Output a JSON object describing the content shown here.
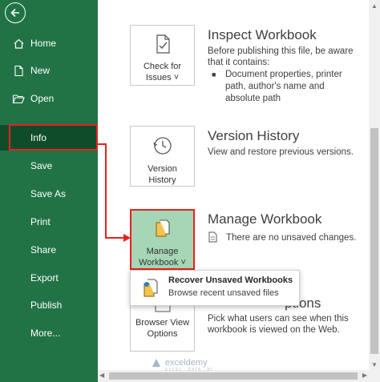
{
  "sidebar": {
    "items": [
      {
        "label": "Home",
        "icon": "home-icon"
      },
      {
        "label": "New",
        "icon": "new-document-icon"
      },
      {
        "label": "Open",
        "icon": "folder-open-icon"
      },
      {
        "label": "Info"
      },
      {
        "label": "Save"
      },
      {
        "label": "Save As"
      },
      {
        "label": "Print"
      },
      {
        "label": "Share"
      },
      {
        "label": "Export"
      },
      {
        "label": "Publish"
      },
      {
        "label": "More..."
      }
    ]
  },
  "inspect": {
    "tile_line1": "Check for",
    "tile_line2": "Issues ˅",
    "title": "Inspect Workbook",
    "desc1": "Before publishing this file, be aware",
    "desc2": "that it contains:",
    "bullet": "Document properties, printer path, author's name and absolute path"
  },
  "version": {
    "tile_line1": "Version",
    "tile_line2": "History",
    "title": "Version History",
    "desc": "View and restore previous versions."
  },
  "manage": {
    "tile_line1": "Manage",
    "tile_line2": "Workbook ˅",
    "title": "Manage Workbook",
    "desc": "There are no unsaved changes."
  },
  "dropdown": {
    "title": "Recover Unsaved Workbooks",
    "desc": "Browse recent unsaved files"
  },
  "browser": {
    "tile_line1": "Browser View",
    "tile_line2": "Options",
    "title_partial": "ptions",
    "desc1": "Pick what users can see when this",
    "desc2": "workbook is viewed on the Web."
  },
  "watermark": {
    "name": "exceldemy",
    "tagline": "EXCEL · DATA · BI"
  },
  "colors": {
    "sidebar": "#217346",
    "selected": "#0f4d2a",
    "highlight": "#e8211c",
    "active_tile": "#a6d6b5"
  }
}
